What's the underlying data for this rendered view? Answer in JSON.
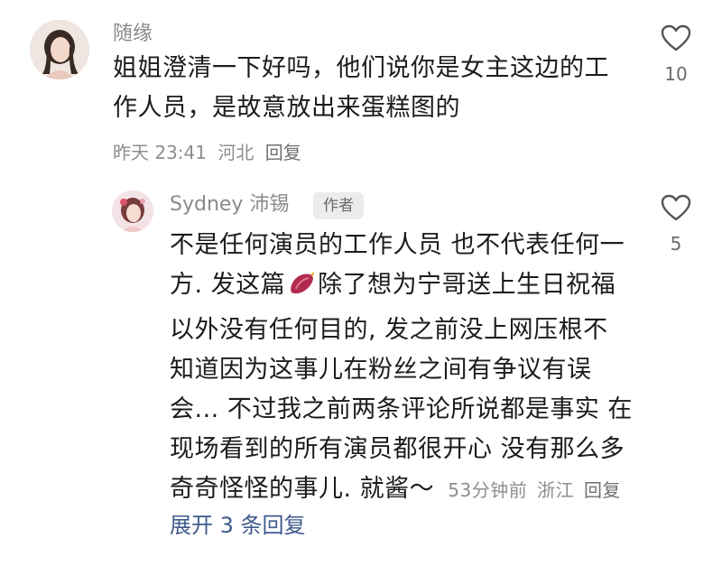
{
  "comment": {
    "username": "随缘",
    "text_line1": "姐姐澄清一下好吗，他们说你是女主这边的工",
    "text_line2": "作人员，是故意放出来蛋糕图的",
    "time": "昨天 23:41",
    "location": "河北",
    "reply_label": "回复",
    "like_count": "10",
    "like_icon": "heart-outline-icon"
  },
  "reply": {
    "username": "Sydney 沛锡",
    "badge": "作者",
    "lines": [
      "不是任何演员的工作人员 也不代表任何一",
      "除了想为宁哥送上生日祝福",
      "以外没有任何目的, 发之前没上网压根不",
      "知道因为这事儿在粉丝之间有争议有误",
      "会... 不过我之前两条评论所说都是事实 在",
      "现场看到的所有演员都很开心 没有那么多",
      "奇奇怪怪的事儿. 就酱～"
    ],
    "line2_prefix": "方. 发这篇",
    "emoji_icon": "sweet-potato-icon",
    "time": "53分钟前",
    "location": "浙江",
    "reply_label": "回复",
    "like_count": "5",
    "like_icon": "heart-outline-icon"
  },
  "expand_label": "展开 3 条回复",
  "colors": {
    "meta": "#8e8e8e",
    "link": "#3f5a8c",
    "badge_bg": "#ececec"
  }
}
